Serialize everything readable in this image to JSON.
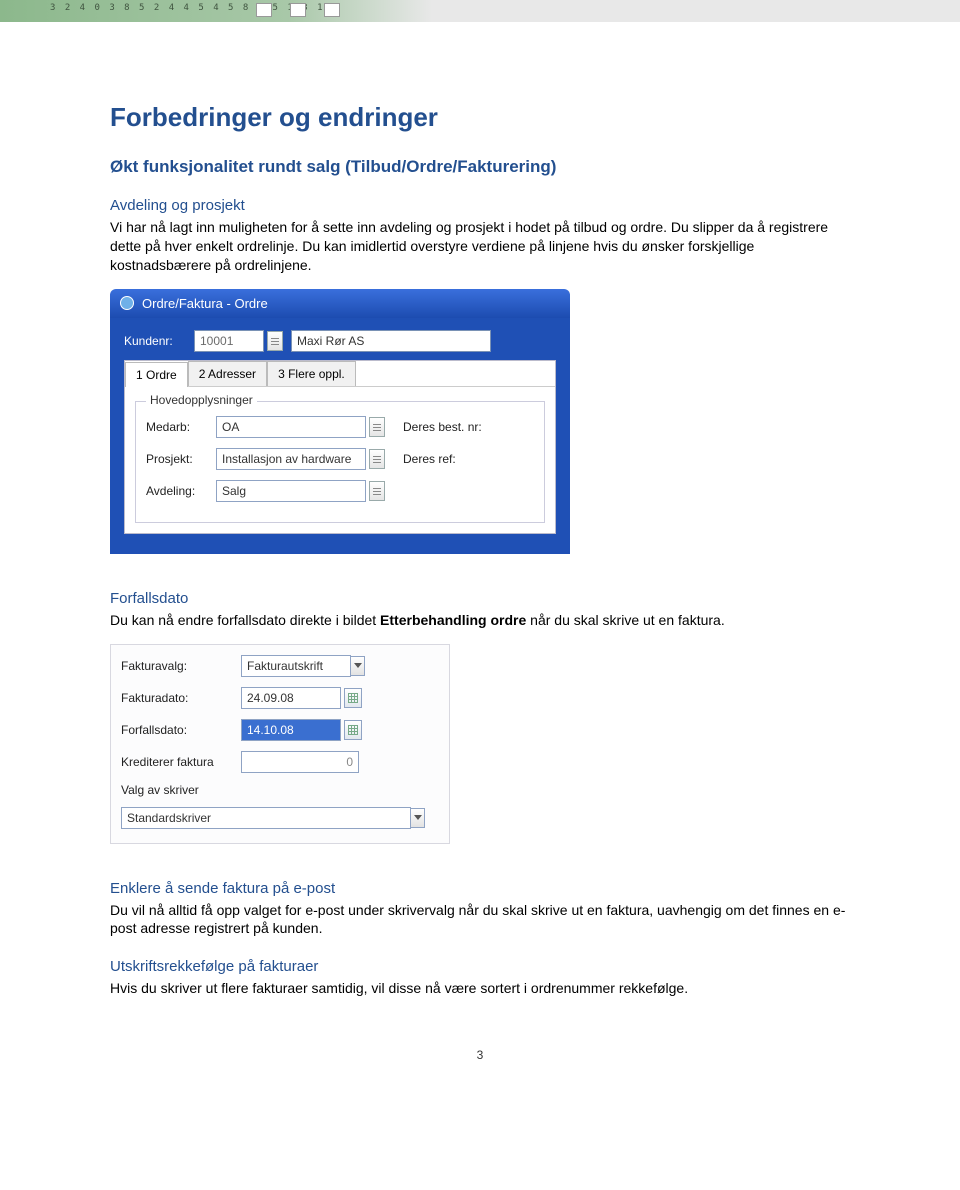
{
  "banner": {
    "numbers": "3 2   4 0 3     8 5  2    4    4 5    4 5   8     8 5         1   3 1  5"
  },
  "headings": {
    "main": "Forbedringer og endringer",
    "sub": "Økt funksjonalitet rundt salg (Tilbud/Ordre/Fakturering)"
  },
  "sections": {
    "avdeling": {
      "title": "Avdeling og prosjekt",
      "body": "Vi har nå lagt inn muligheten for å sette inn avdeling og prosjekt i hodet på tilbud og ordre. Du slipper da å registrere dette på hver enkelt ordrelinje. Du kan imidlertid overstyre verdiene på linjene hvis du ønsker forskjellige kostnadsbærere på ordrelinjene."
    },
    "forfall": {
      "title": "Forfallsdato",
      "body_pre": "Du kan nå endre forfallsdato direkte i bildet ",
      "body_bold": "Etterbehandling ordre",
      "body_post": " når du skal skrive ut en faktura."
    },
    "epost": {
      "title": "Enklere å sende faktura på e-post",
      "body": "Du vil nå alltid få opp valget for e-post under skrivervalg når du skal skrive ut en faktura, uavhengig om det finnes en e-post adresse registrert på kunden."
    },
    "utskrift": {
      "title": "Utskriftsrekkefølge på fakturaer",
      "body": "Hvis du skriver ut flere fakturaer samtidig, vil disse nå være sortert i ordrenummer rekkefølge."
    }
  },
  "shot1": {
    "titlebar": "Ordre/Faktura - Ordre",
    "kundenr_label": "Kundenr:",
    "kundenr_value": "10001",
    "kundenavn": "Maxi Rør AS",
    "tabs": [
      "1 Ordre",
      "2 Adresser",
      "3 Flere oppl."
    ],
    "fieldset_legend": "Hovedopplysninger",
    "rows": {
      "medarb": {
        "label": "Medarb:",
        "value": "OA",
        "right": "Deres best. nr:"
      },
      "prosjekt": {
        "label": "Prosjekt:",
        "value": "Installasjon av hardware",
        "right": "Deres ref:"
      },
      "avdeling": {
        "label": "Avdeling:",
        "value": "Salg"
      }
    }
  },
  "shot2": {
    "rows": {
      "fakturavalg": {
        "label": "Fakturavalg:",
        "value": "Fakturautskrift"
      },
      "fakturadato": {
        "label": "Fakturadato:",
        "value": "24.09.08"
      },
      "forfallsdato": {
        "label": "Forfallsdato:",
        "value": "14.10.08"
      },
      "krediterer": {
        "label": "Krediterer faktura",
        "value": "0"
      },
      "valgskriver": {
        "label": "Valg av skriver"
      },
      "skriver": {
        "value": "Standardskriver"
      }
    }
  },
  "page_number": "3"
}
